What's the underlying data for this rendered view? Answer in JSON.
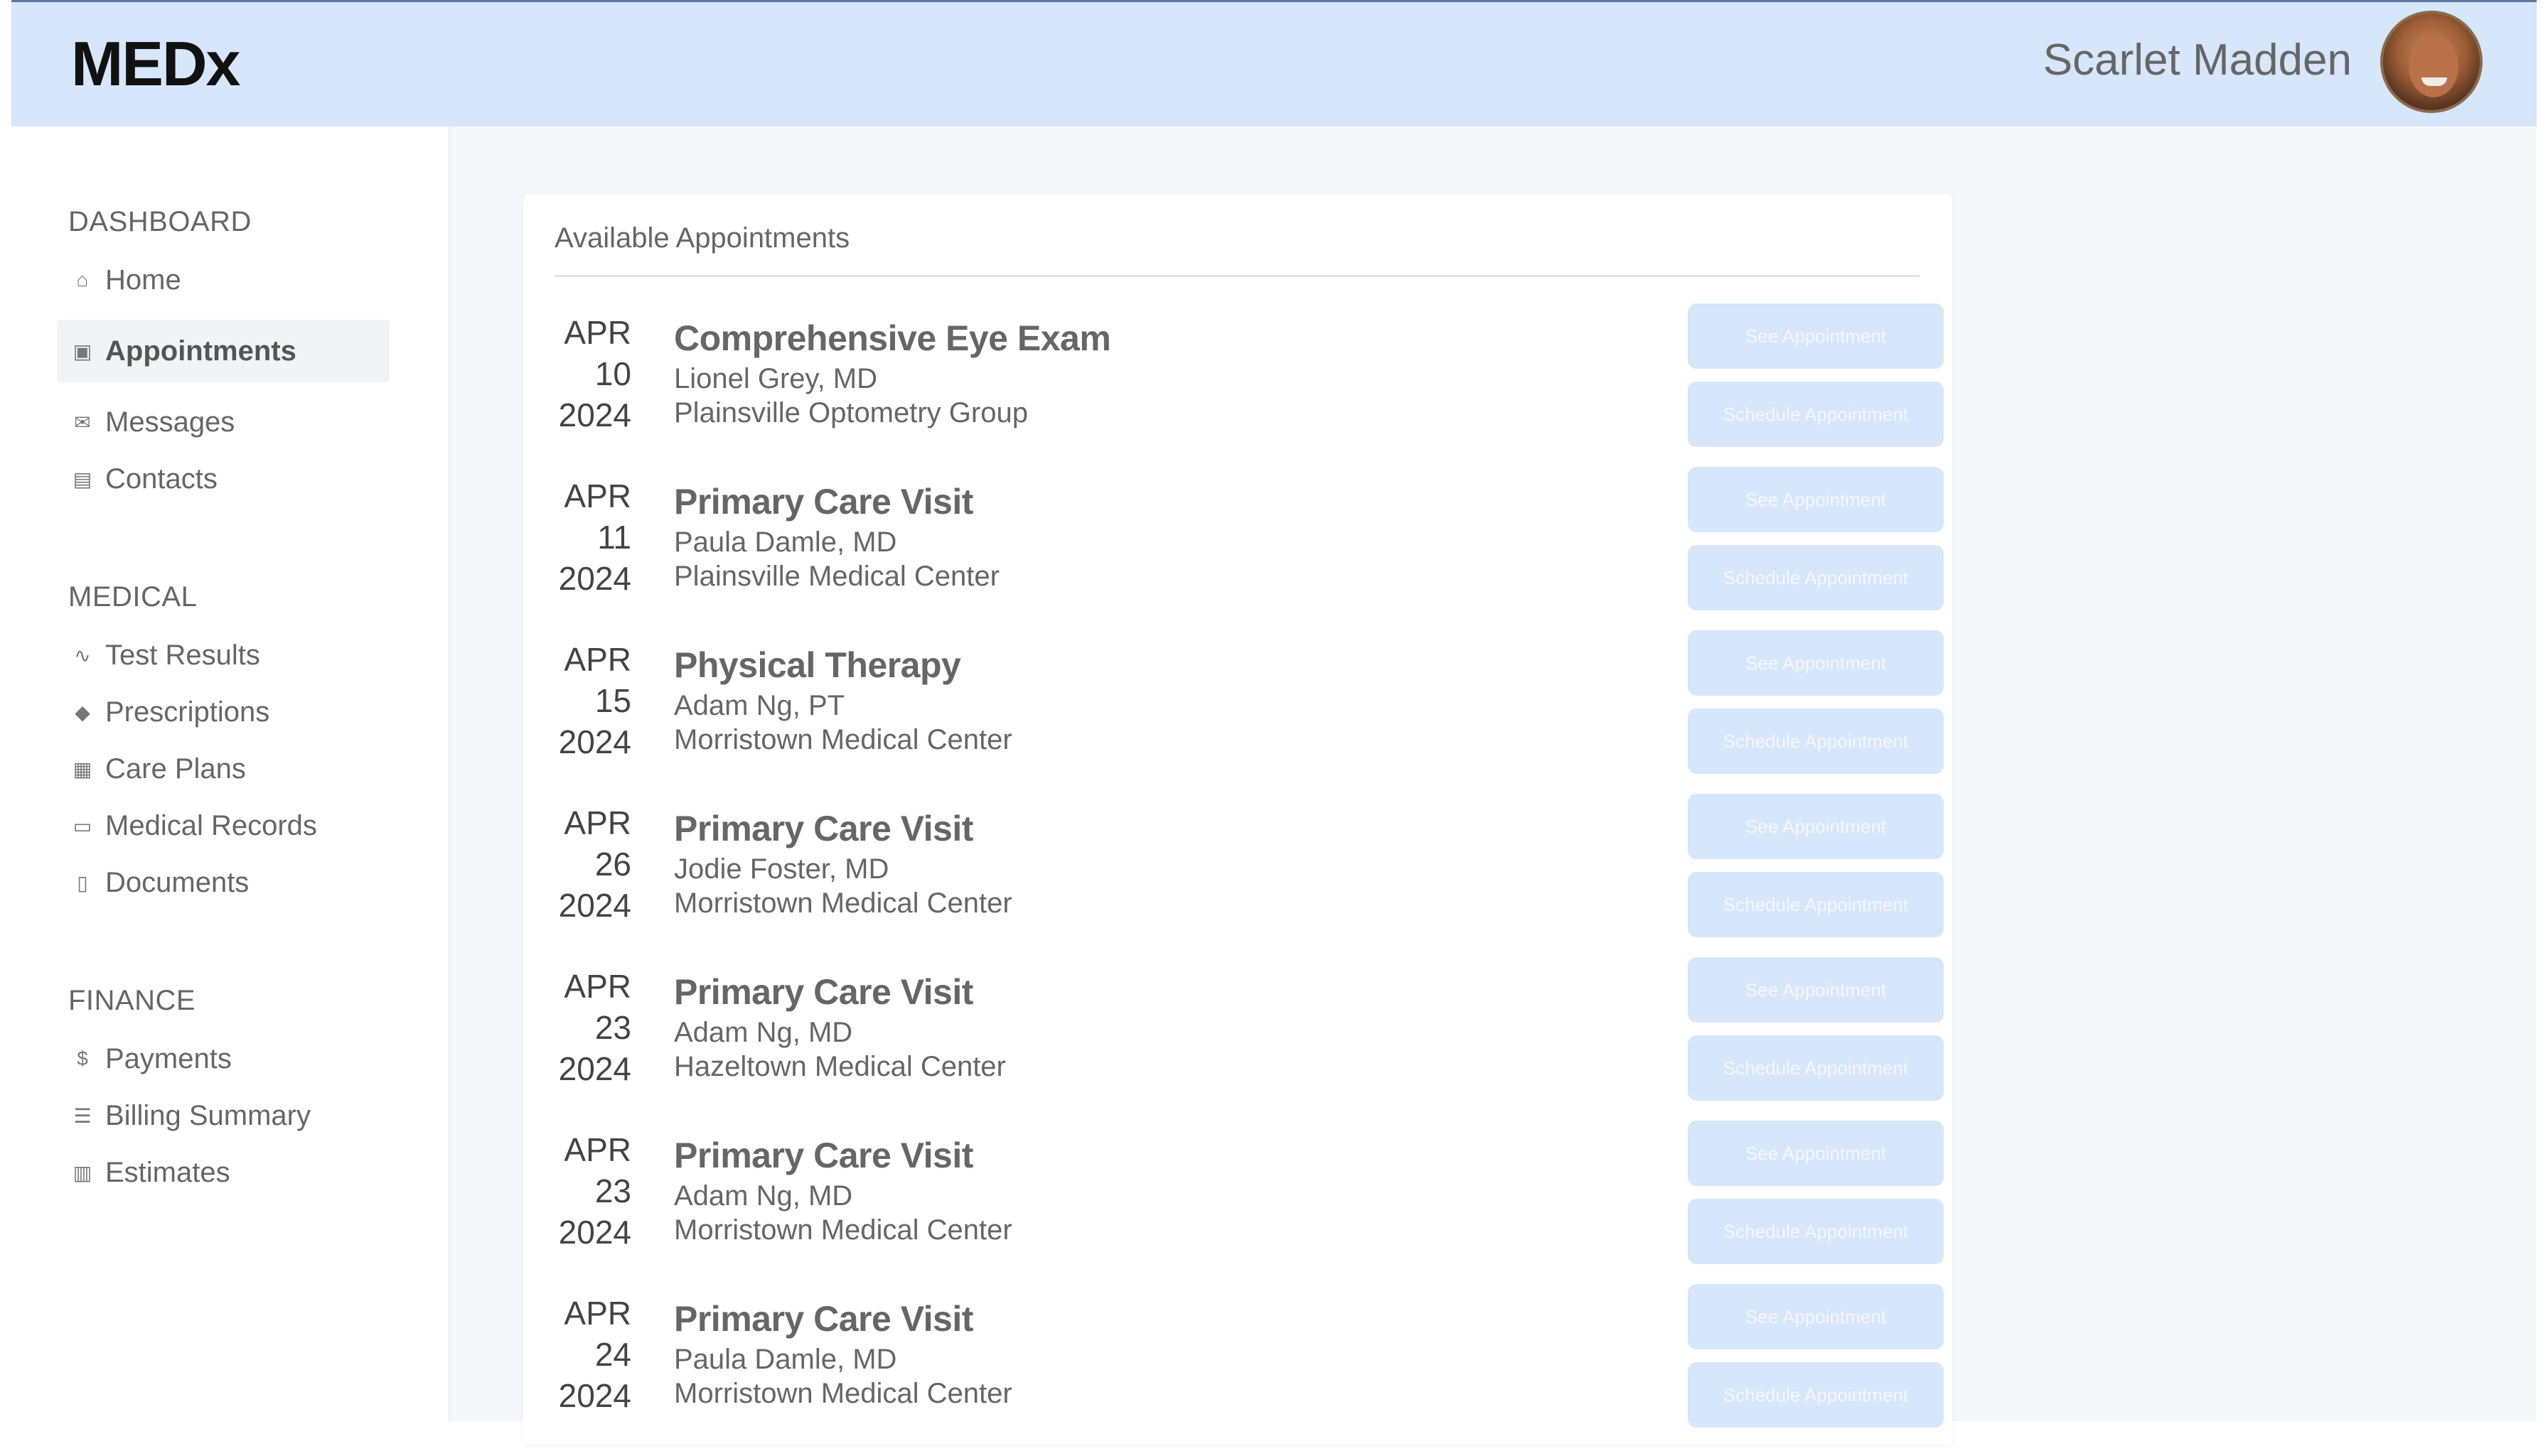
{
  "header": {
    "logo": "MEDx",
    "user_name": "Scarlet Madden"
  },
  "sidebar": {
    "sections": [
      {
        "title": "DASHBOARD",
        "items": [
          {
            "label": "Home",
            "icon": "home-icon",
            "active": false
          },
          {
            "label": "Appointments",
            "icon": "calendar-icon",
            "active": true
          },
          {
            "label": "Messages",
            "icon": "envelope-icon",
            "active": false
          },
          {
            "label": "Contacts",
            "icon": "contact-card-icon",
            "active": false
          }
        ]
      },
      {
        "title": "MEDICAL",
        "items": [
          {
            "label": "Test Results",
            "icon": "pulse-icon",
            "active": false
          },
          {
            "label": "Prescriptions",
            "icon": "pill-icon",
            "active": false
          },
          {
            "label": "Care Plans",
            "icon": "hospital-icon",
            "active": false
          },
          {
            "label": "Medical Records",
            "icon": "folder-icon",
            "active": false
          },
          {
            "label": "Documents",
            "icon": "document-icon",
            "active": false
          }
        ]
      },
      {
        "title": "FINANCE",
        "items": [
          {
            "label": "Payments",
            "icon": "dollar-circle-icon",
            "active": false
          },
          {
            "label": "Billing Summary",
            "icon": "receipt-icon",
            "active": false
          },
          {
            "label": "Estimates",
            "icon": "calculator-icon",
            "active": false
          }
        ]
      }
    ]
  },
  "main": {
    "card_title": "Available Appointments",
    "see_label": "See Appointment",
    "schedule_label": "Schedule Appointment",
    "appointments": [
      {
        "month": "APR",
        "day": "10",
        "year": "2024",
        "title": "Comprehensive Eye Exam",
        "doctor": "Lionel Grey, MD",
        "location": "Plainsville Optometry Group"
      },
      {
        "month": "APR",
        "day": "11",
        "year": "2024",
        "title": "Primary Care Visit",
        "doctor": "Paula Damle, MD",
        "location": "Plainsville Medical Center"
      },
      {
        "month": "APR",
        "day": "15",
        "year": "2024",
        "title": "Physical Therapy",
        "doctor": "Adam Ng, PT",
        "location": "Morristown Medical Center"
      },
      {
        "month": "APR",
        "day": "26",
        "year": "2024",
        "title": "Primary Care Visit",
        "doctor": "Jodie Foster, MD",
        "location": "Morristown Medical Center"
      },
      {
        "month": "APR",
        "day": "23",
        "year": "2024",
        "title": "Primary Care Visit",
        "doctor": "Adam Ng, MD",
        "location": "Hazeltown Medical Center"
      },
      {
        "month": "APR",
        "day": "23",
        "year": "2024",
        "title": "Primary Care Visit",
        "doctor": "Adam Ng, MD",
        "location": "Morristown Medical Center"
      },
      {
        "month": "APR",
        "day": "24",
        "year": "2024",
        "title": "Primary Care Visit",
        "doctor": "Paula Damle, MD",
        "location": "Morristown Medical Center"
      }
    ]
  }
}
